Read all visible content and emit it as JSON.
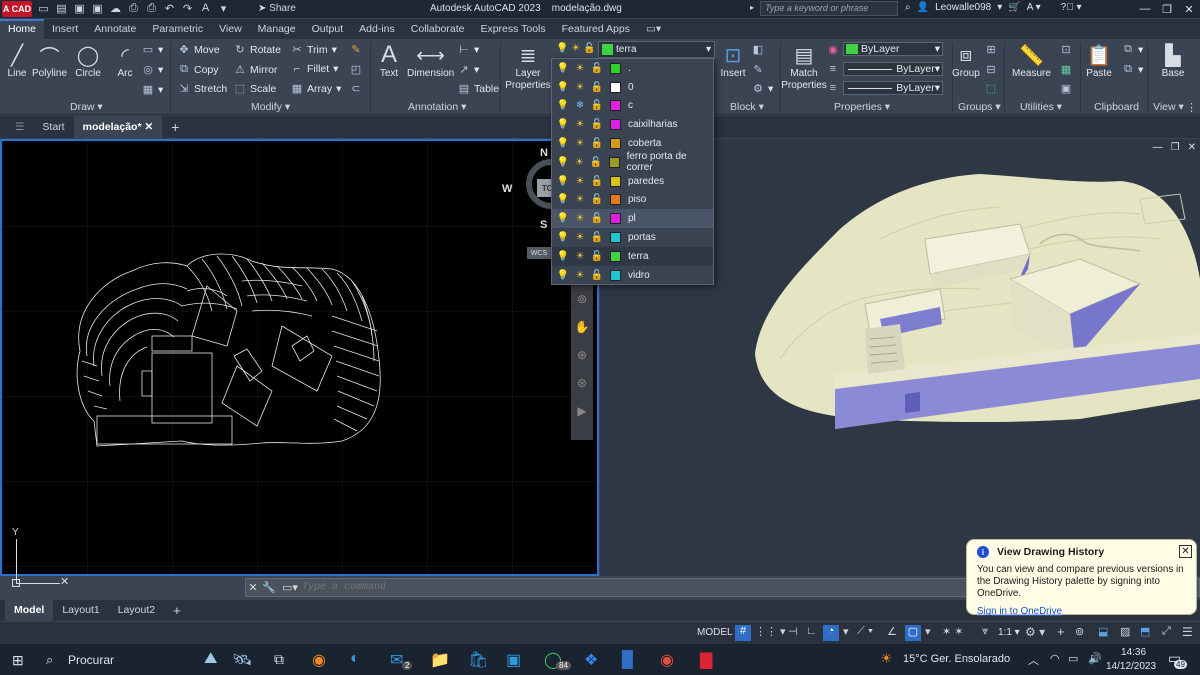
{
  "title_bar": {
    "logo_text": "A CAD",
    "share_label": "Share",
    "app_title": "Autodesk AutoCAD 2023",
    "file_name": "modelação.dwg",
    "search_placeholder": "Type a keyword or phrase",
    "username": "Leowalle098"
  },
  "ribbon_tabs": [
    "Home",
    "Insert",
    "Annotate",
    "Parametric",
    "View",
    "Manage",
    "Output",
    "Add-ins",
    "Collaborate",
    "Express Tools",
    "Featured Apps"
  ],
  "ribbon": {
    "draw": {
      "title": "Draw",
      "line": "Line",
      "polyline": "Polyline",
      "circle": "Circle",
      "arc": "Arc"
    },
    "modify": {
      "title": "Modify",
      "move": "Move",
      "rotate": "Rotate",
      "trim": "Trim",
      "copy": "Copy",
      "mirror": "Mirror",
      "fillet": "Fillet",
      "stretch": "Stretch",
      "scale": "Scale",
      "array": "Array"
    },
    "annotation": {
      "title": "Annotation",
      "text": "Text",
      "dimension": "Dimension",
      "table": "Table"
    },
    "layers": {
      "layer_properties": "Layer Properties",
      "current_layer": "terra",
      "current_color": "#3fd43f"
    },
    "block": {
      "title": "Block",
      "insert": "Insert"
    },
    "properties": {
      "title": "Properties",
      "match": "Match Properties",
      "color": "ByLayer",
      "linetype": "ByLayer",
      "lineweight": "ByLayer"
    },
    "groups": {
      "title": "Groups",
      "group": "Group"
    },
    "utilities": {
      "title": "Utilities",
      "measure": "Measure"
    },
    "clipboard": {
      "title": "Clipboard",
      "paste": "Paste"
    },
    "view": {
      "title": "View",
      "base": "Base"
    }
  },
  "doc_tabs": {
    "start": "Start",
    "current": "modelação*"
  },
  "layer_dropdown": [
    {
      "name": ".",
      "color": "#2fd12f"
    },
    {
      "name": "0",
      "color": "#ffffff"
    },
    {
      "name": "c",
      "color": "#e020e0"
    },
    {
      "name": "caixilharias",
      "color": "#e020e0"
    },
    {
      "name": "coberta",
      "color": "#d19a1f"
    },
    {
      "name": "ferro porta de correr",
      "color": "#9c9a28"
    },
    {
      "name": "paredes",
      "color": "#d6c21c"
    },
    {
      "name": "piso",
      "color": "#e07a1a"
    },
    {
      "name": "pl",
      "color": "#e020e0"
    },
    {
      "name": "portas",
      "color": "#1fc6cf"
    },
    {
      "name": "terra",
      "color": "#3fd43f"
    },
    {
      "name": "vidro",
      "color": "#1fc6cf"
    }
  ],
  "viewcube": {
    "north": "N",
    "west": "W",
    "south": "S",
    "top": "TOP",
    "wcs": "WCS"
  },
  "ucs": {
    "y": "Y"
  },
  "command": {
    "placeholder": "Type a command"
  },
  "layout_tabs": [
    "Model",
    "Layout1",
    "Layout2"
  ],
  "status_bar": {
    "model": "MODEL",
    "scale": "1:1"
  },
  "toast": {
    "title": "View Drawing History",
    "body": "You can view and compare previous versions in the Drawing History palette by signing into OneDrive.",
    "link": "Sign in to OneDrive"
  },
  "taskbar": {
    "search": "Procurar",
    "whatsapp_badge": "84",
    "mail_badge": "2",
    "weather": "15°C  Ger. Ensolarado",
    "time": "14:36",
    "date": "14/12/2023",
    "notifications": "49"
  }
}
